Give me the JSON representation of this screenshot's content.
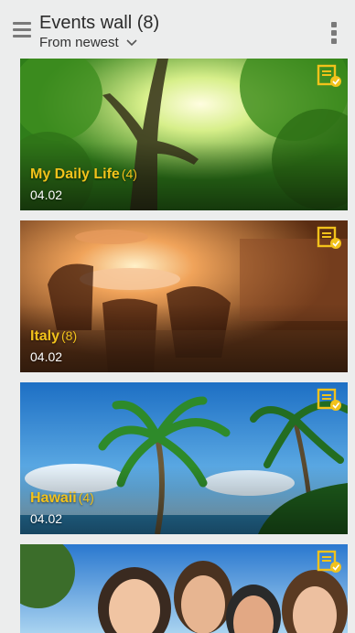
{
  "header": {
    "title": "Events wall (8)",
    "sort_label": "From newest"
  },
  "icons": {
    "menu": "hamburger-icon",
    "sort": "chevron-down-icon",
    "overflow": "overflow-menu-icon",
    "badge": "note-check-icon"
  },
  "colors": {
    "accent": "#f2c21b",
    "background": "#eceded"
  },
  "events": [
    {
      "name": "My Daily Life",
      "count": "(4)",
      "date": "04.02"
    },
    {
      "name": "Italy",
      "count": "(8)",
      "date": "04.02"
    },
    {
      "name": "Hawaii",
      "count": "(4)",
      "date": "04.02"
    },
    {
      "name": "",
      "count": "",
      "date": ""
    }
  ]
}
